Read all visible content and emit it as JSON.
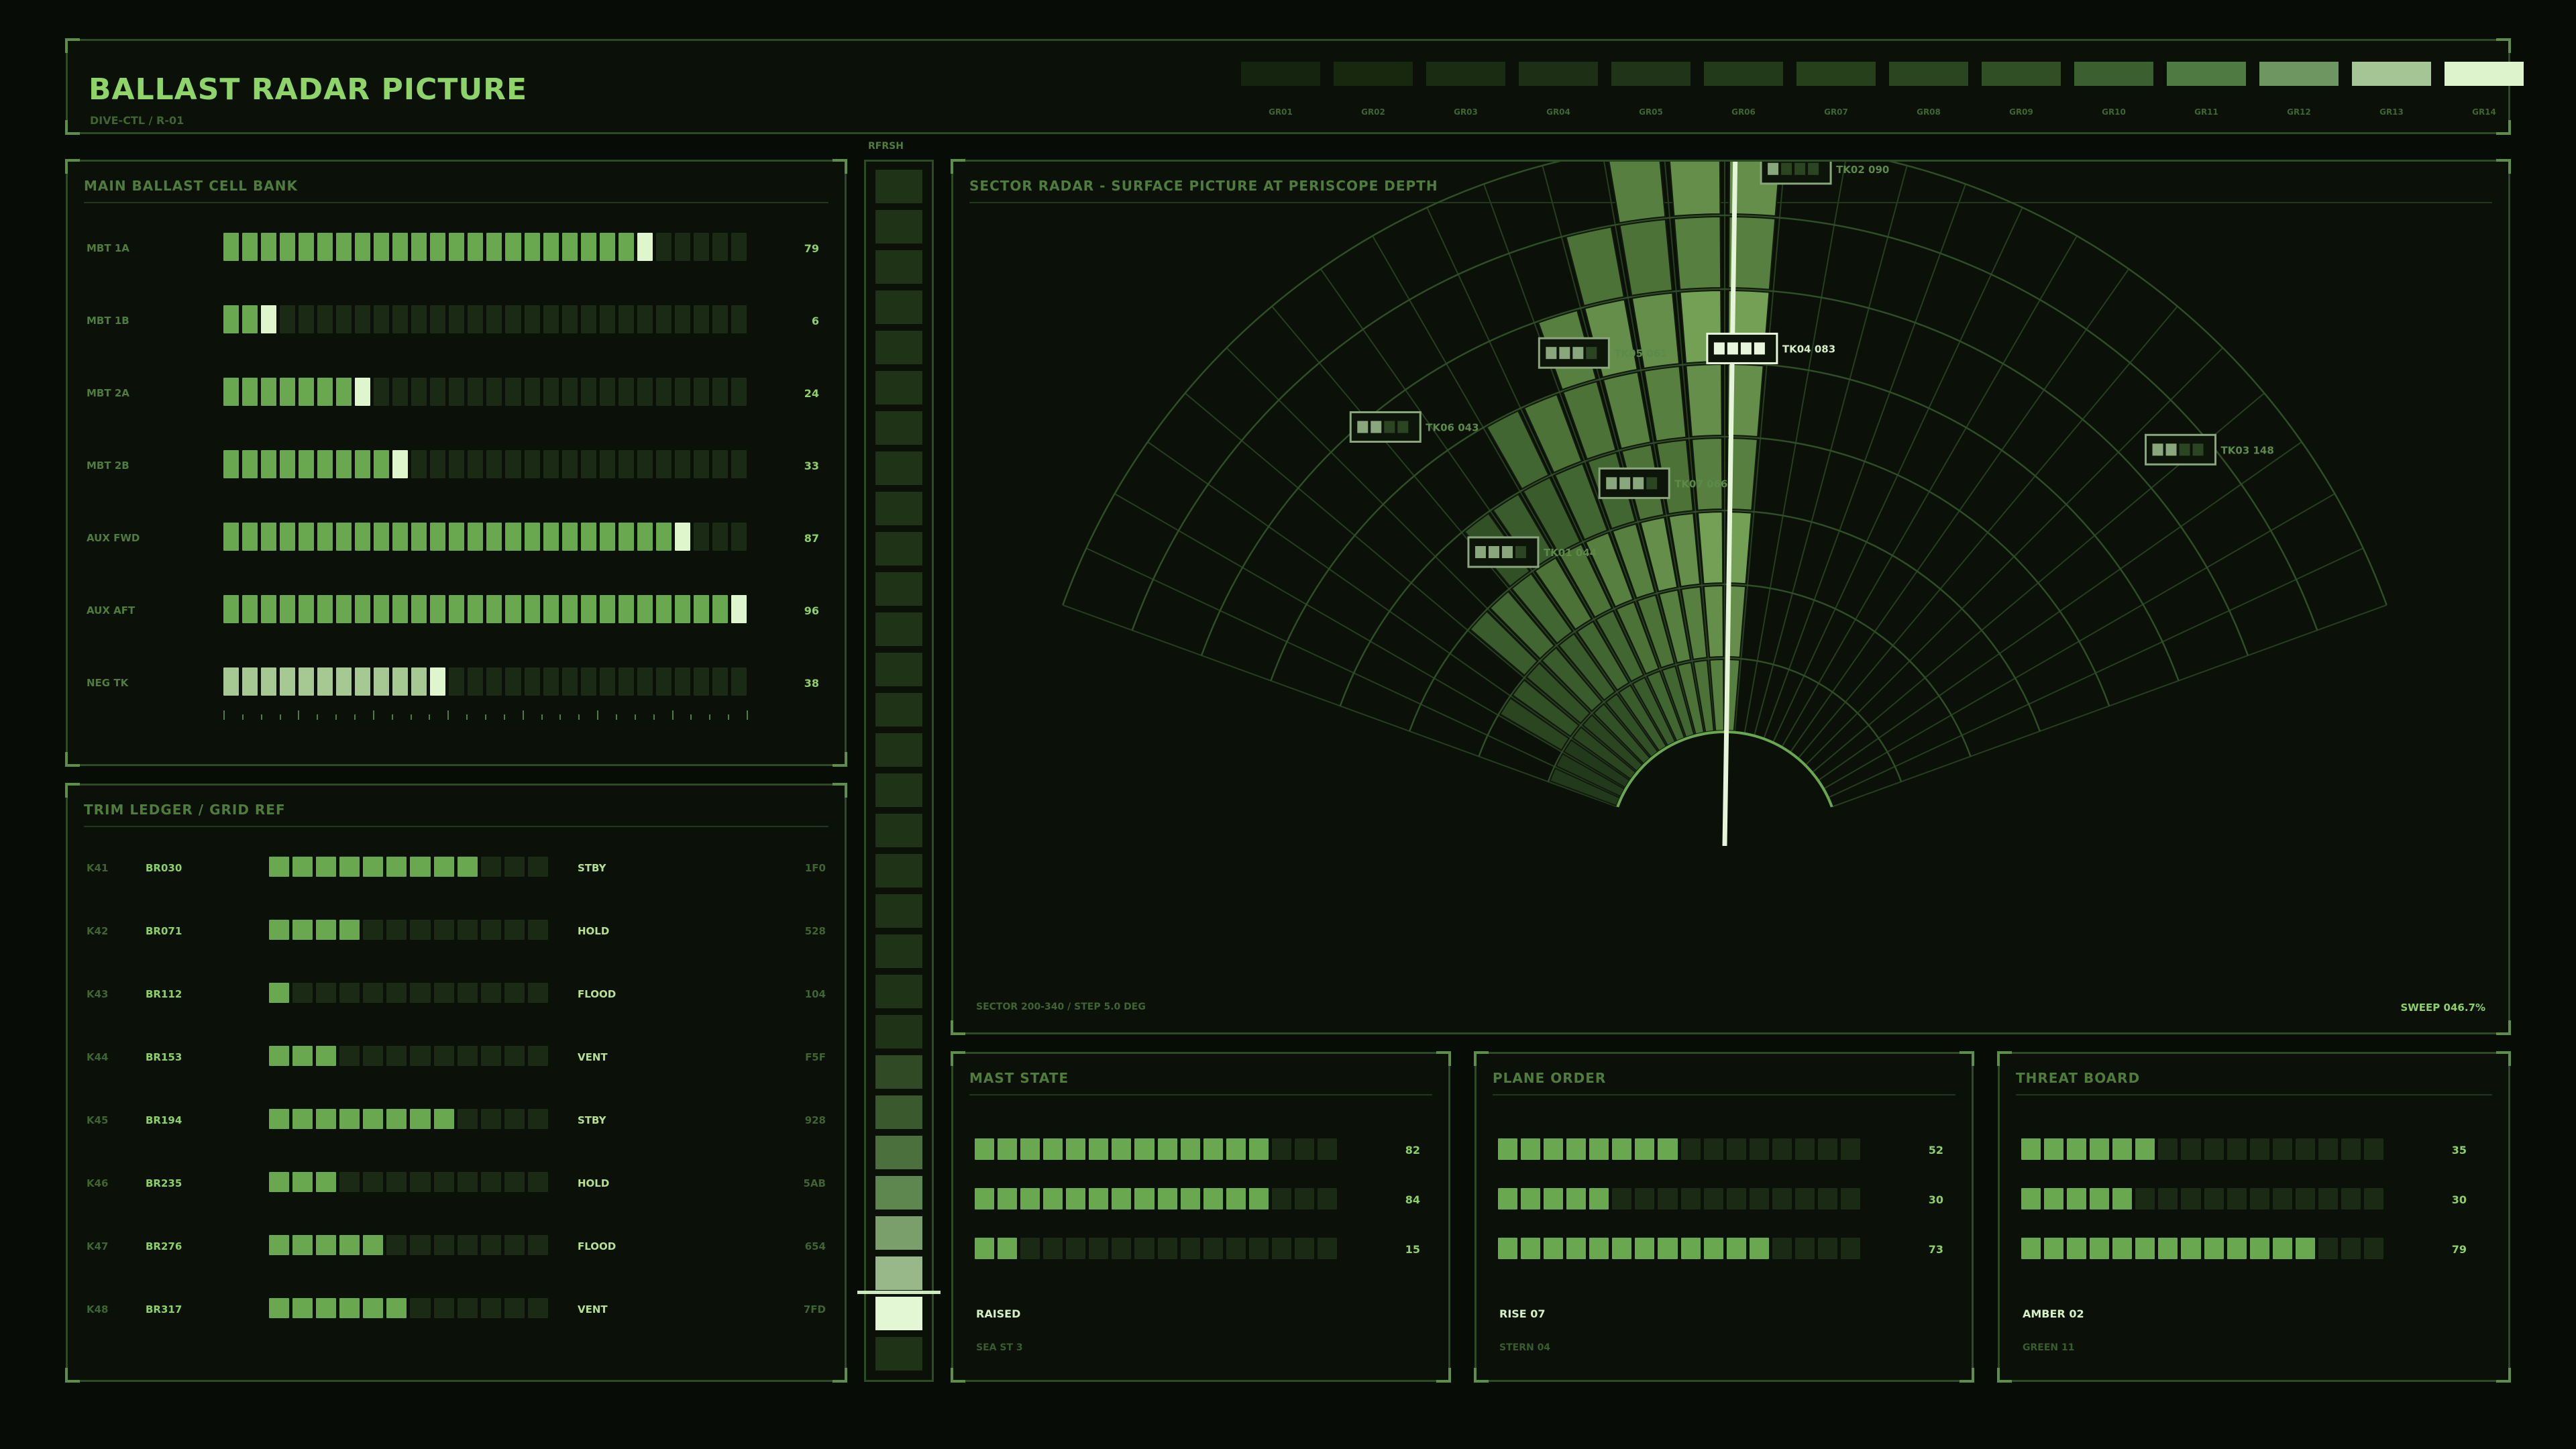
{
  "header": {
    "title": "BALLAST RADAR PICTURE",
    "subtitle": "DIVE-CTL / R-01"
  },
  "color_scale": {
    "labels": [
      "GR01",
      "GR02",
      "GR03",
      "GR04",
      "GR05",
      "GR06",
      "GR07",
      "GR08",
      "GR09",
      "GR10",
      "GR11",
      "GR12",
      "GR13",
      "GR14"
    ],
    "colors": [
      "#15240f",
      "#18280f",
      "#1a2c12",
      "#1d3015",
      "#203518",
      "#233a1a",
      "#26401c",
      "#2a4620",
      "#304f25",
      "#3c5f30",
      "#4f7a42",
      "#6d9661",
      "#a6c594",
      "#ddf3cc"
    ]
  },
  "ballast": {
    "title": "MAIN BALLAST CELL BANK",
    "segments": 28,
    "rows": [
      {
        "label": "MBT 1A",
        "value": "79",
        "fill": 79
      },
      {
        "label": "MBT 1B",
        "value": "6",
        "fill": 6
      },
      {
        "label": "MBT 2A",
        "value": "24",
        "fill": 24
      },
      {
        "label": "MBT 2B",
        "value": "33",
        "fill": 33
      },
      {
        "label": "AUX FWD",
        "value": "87",
        "fill": 87
      },
      {
        "label": "AUX AFT",
        "value": "96",
        "fill": 96
      },
      {
        "label": "NEG TK",
        "value": "38",
        "fill": 38
      }
    ]
  },
  "trim": {
    "title": "TRIM LEDGER / GRID REF",
    "rows": [
      {
        "id": "K41",
        "ref": "BR030",
        "fill": 75,
        "status": "STBY",
        "code": "1F0"
      },
      {
        "id": "K42",
        "ref": "BR071",
        "fill": 33,
        "status": "HOLD",
        "code": "528"
      },
      {
        "id": "K43",
        "ref": "BR112",
        "fill": 8,
        "status": "FLOOD",
        "code": "104"
      },
      {
        "id": "K44",
        "ref": "BR153",
        "fill": 25,
        "status": "VENT",
        "code": "F5F"
      },
      {
        "id": "K45",
        "ref": "BR194",
        "fill": 67,
        "status": "STBY",
        "code": "928"
      },
      {
        "id": "K46",
        "ref": "BR235",
        "fill": 25,
        "status": "HOLD",
        "code": "5AB"
      },
      {
        "id": "K47",
        "ref": "BR276",
        "fill": 42,
        "status": "FLOOD",
        "code": "654"
      },
      {
        "id": "K48",
        "ref": "BR317",
        "fill": 50,
        "status": "VENT",
        "code": "7FD"
      }
    ]
  },
  "refresh": {
    "label": "RFRSH",
    "cells": 30,
    "active_index": 28
  },
  "radar": {
    "title": "SECTOR RADAR - SURFACE PICTURE AT PERISCOPE DEPTH",
    "footer_left": "SECTOR 200-340 / STEP 5.0 DEG",
    "footer_right": "SWEEP 046.7%",
    "sector_start_deg": 200,
    "sector_end_deg": 340,
    "step_deg": 5,
    "rings": 8,
    "sweep_fraction": 0.467,
    "contacts": [
      {
        "label": "TK02 090",
        "bearing": 276,
        "range": 0.96,
        "fill": 1
      },
      {
        "label": "TK04 083",
        "bearing": 272,
        "range": 0.65,
        "fill": 4,
        "active": true
      },
      {
        "label": "TK05 061",
        "bearing": 253,
        "range": 0.68,
        "fill": 3
      },
      {
        "label": "TK06 043",
        "bearing": 231,
        "range": 0.72,
        "fill": 2
      },
      {
        "label": "TK07 066",
        "bearing": 256,
        "range": 0.44,
        "fill": 3
      },
      {
        "label": "TK01 044",
        "bearing": 233,
        "range": 0.43,
        "fill": 3
      },
      {
        "label": "TK03 148",
        "bearing": 319,
        "range": 0.83,
        "fill": 2
      }
    ]
  },
  "mast": {
    "title": "MAST STATE",
    "rows": [
      {
        "value": "82",
        "fill": 82
      },
      {
        "value": "84",
        "fill": 84
      },
      {
        "value": "15",
        "fill": 15
      }
    ],
    "status": "RAISED",
    "sub": "SEA ST 3"
  },
  "plane": {
    "title": "PLANE ORDER",
    "rows": [
      {
        "value": "52",
        "fill": 52
      },
      {
        "value": "30",
        "fill": 30
      },
      {
        "value": "73",
        "fill": 73
      }
    ],
    "status": "RISE 07",
    "sub": "STERN 04"
  },
  "threat": {
    "title": "THREAT BOARD",
    "rows": [
      {
        "value": "35",
        "fill": 35
      },
      {
        "value": "30",
        "fill": 30
      },
      {
        "value": "79",
        "fill": 79
      }
    ],
    "status": "AMBER 02",
    "sub": "GREEN 11"
  }
}
